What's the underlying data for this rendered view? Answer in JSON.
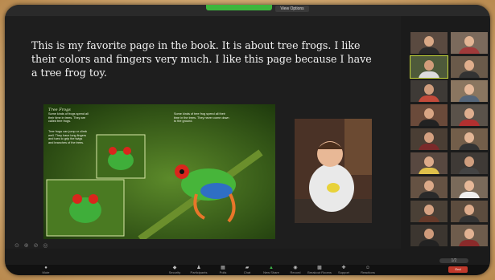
{
  "topbar": {
    "view_options": "View Options",
    "right_text": ""
  },
  "caption": "This is my favorite page in the book. It is about tree frogs. I like their colors and fingers very much. I like this page because I have a tree frog toy.",
  "book": {
    "title": "Tree Frogs",
    "text1": "Some kinds of frogs spend all their time in trees. They are called tree frogs.",
    "text2": "Tree frogs can jump or climb well. They have long fingers and toes to grip the twigs and branches of the trees.",
    "text3": "Some kinds of tree frog spend all their time in the trees. They never come down to the ground."
  },
  "annotate_tools": "⊙ ⊕ ⊘ ◎",
  "gallery_pager": "1/2",
  "toolbar": {
    "items": [
      {
        "label": "Mute",
        "icon": "microphone-icon"
      },
      {
        "label": "Security",
        "icon": "shield-icon"
      },
      {
        "label": "Participants",
        "icon": "participants-icon"
      },
      {
        "label": "Polls",
        "icon": "polls-icon"
      },
      {
        "label": "Chat",
        "icon": "chat-icon"
      },
      {
        "label": "New Share",
        "icon": "share-icon"
      },
      {
        "label": "Record",
        "icon": "record-icon"
      },
      {
        "label": "Breakout Rooms",
        "icon": "breakout-icon"
      },
      {
        "label": "Support",
        "icon": "support-icon"
      },
      {
        "label": "Reactions",
        "icon": "reactions-icon"
      }
    ],
    "end_label": "End"
  },
  "colors": {
    "share_green": "#3db63d",
    "active_speaker": "#c8d83a",
    "end_red": "#c0392b"
  }
}
